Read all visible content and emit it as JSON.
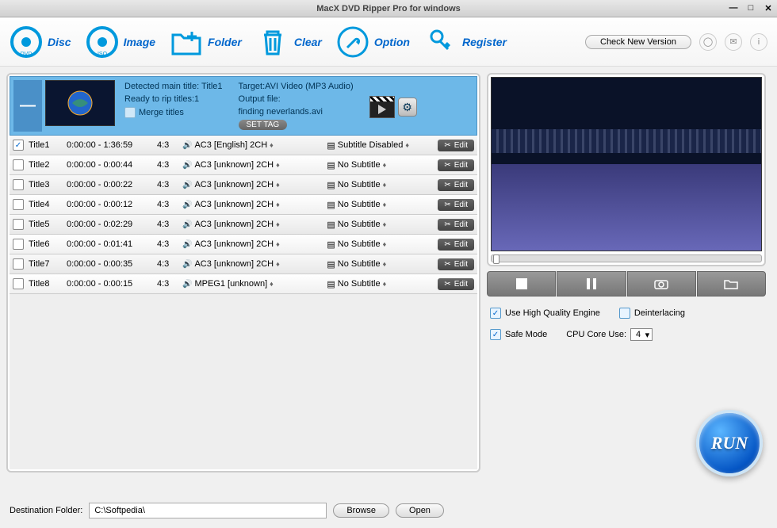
{
  "titlebar": {
    "title": "MacX DVD Ripper Pro for windows"
  },
  "toolbar": {
    "disc": "Disc",
    "image": "Image",
    "folder": "Folder",
    "clear": "Clear",
    "option": "Option",
    "register": "Register",
    "check_version": "Check New Version"
  },
  "info": {
    "detected": "Detected main title: Title1",
    "ready": "Ready to rip titles:1",
    "merge": "Merge titles",
    "target": "Target:AVI Video (MP3 Audio)",
    "output_label": "Output file:",
    "output_file": "finding neverlands.avi",
    "settag": "SET TAG"
  },
  "titles": [
    {
      "checked": true,
      "name": "Title1",
      "time": "0:00:00 - 1:36:59",
      "ar": "4:3",
      "audio": "AC3  [English]  2CH",
      "sub": "Subtitle Disabled"
    },
    {
      "checked": false,
      "name": "Title2",
      "time": "0:00:00 - 0:00:44",
      "ar": "4:3",
      "audio": "AC3  [unknown]  2CH",
      "sub": "No Subtitle"
    },
    {
      "checked": false,
      "name": "Title3",
      "time": "0:00:00 - 0:00:22",
      "ar": "4:3",
      "audio": "AC3  [unknown]  2CH",
      "sub": "No Subtitle"
    },
    {
      "checked": false,
      "name": "Title4",
      "time": "0:00:00 - 0:00:12",
      "ar": "4:3",
      "audio": "AC3  [unknown]  2CH",
      "sub": "No Subtitle"
    },
    {
      "checked": false,
      "name": "Title5",
      "time": "0:00:00 - 0:02:29",
      "ar": "4:3",
      "audio": "AC3  [unknown]  2CH",
      "sub": "No Subtitle"
    },
    {
      "checked": false,
      "name": "Title6",
      "time": "0:00:00 - 0:01:41",
      "ar": "4:3",
      "audio": "AC3  [unknown]  2CH",
      "sub": "No Subtitle"
    },
    {
      "checked": false,
      "name": "Title7",
      "time": "0:00:00 - 0:00:35",
      "ar": "4:3",
      "audio": "AC3  [unknown]  2CH",
      "sub": "No Subtitle"
    },
    {
      "checked": false,
      "name": "Title8",
      "time": "0:00:00 - 0:00:15",
      "ar": "4:3",
      "audio": "MPEG1  [unknown]",
      "sub": "No Subtitle"
    }
  ],
  "edit_label": "Edit",
  "options": {
    "hq": "Use High Quality Engine",
    "deint": "Deinterlacing",
    "safe": "Safe Mode",
    "cpu": "CPU Core Use:",
    "cpu_val": "4"
  },
  "run": "RUN",
  "dest": {
    "label": "Destination Folder:",
    "value": "C:\\Softpedia\\",
    "browse": "Browse",
    "open": "Open"
  }
}
